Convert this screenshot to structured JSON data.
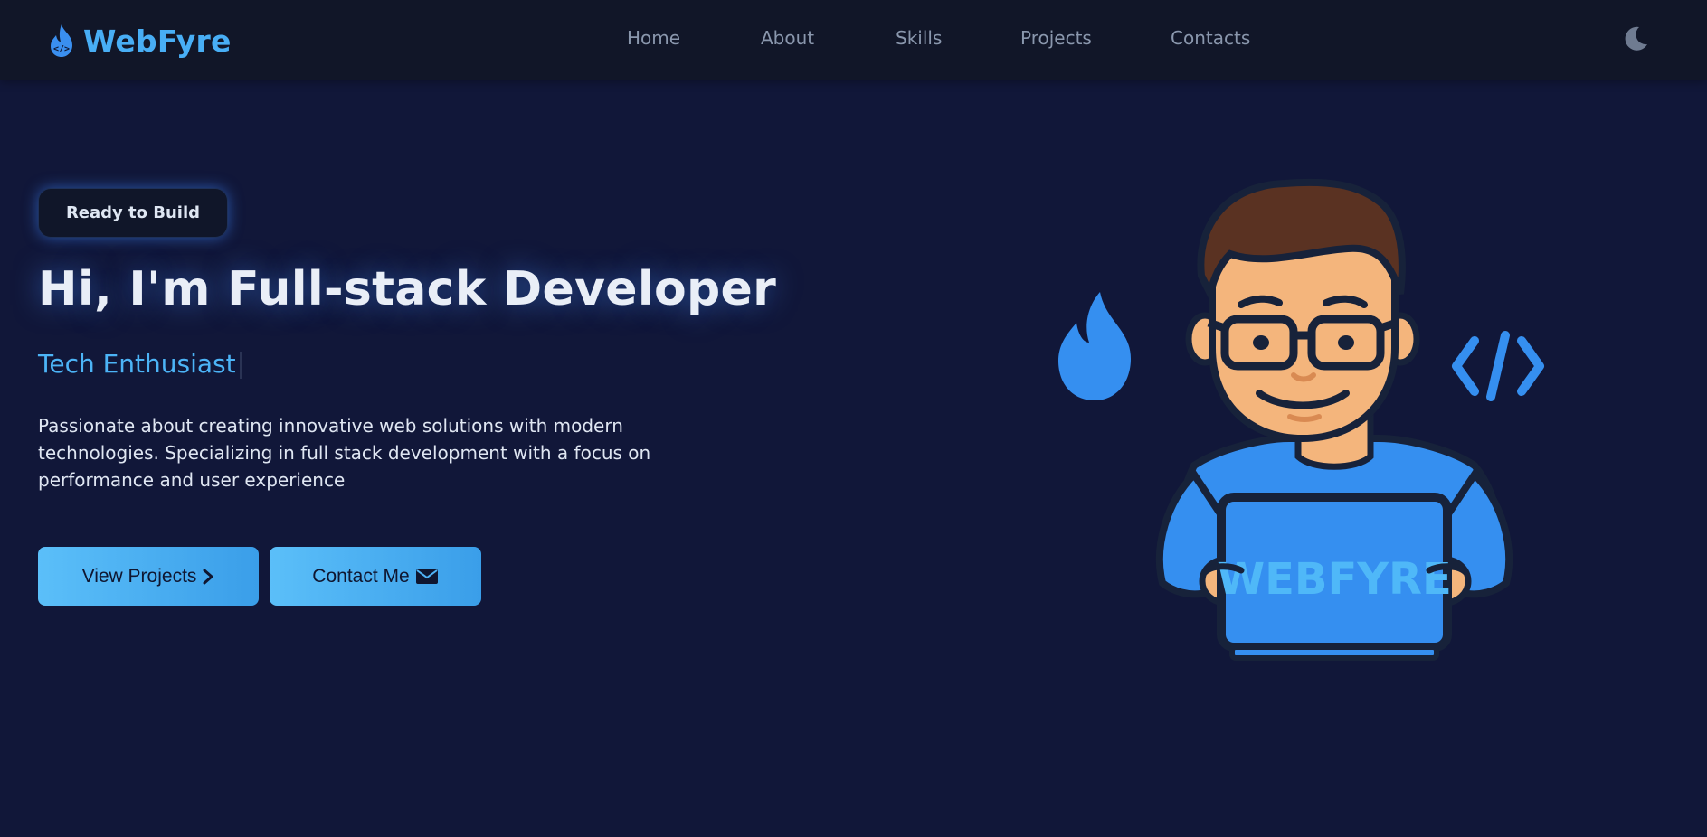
{
  "brand": {
    "name": "WebFyre",
    "icon": "flame-code-icon",
    "color": "#48aef5"
  },
  "nav": {
    "items": [
      {
        "label": "Home"
      },
      {
        "label": "About"
      },
      {
        "label": "Skills"
      },
      {
        "label": "Projects"
      },
      {
        "label": "Contacts"
      }
    ],
    "theme_toggle_icon": "moon-icon"
  },
  "hero": {
    "badge": "Ready to Build",
    "title": "Hi, I'm Full-stack Developer",
    "subtitle": "Tech Enthusiast",
    "description": "Passionate about creating innovative web solutions with modern technologies. Specializing in full stack development with a focus on performance and user experience",
    "buttons": {
      "projects_label": "View Projects",
      "projects_icon": "chevron-right-icon",
      "contact_label": "Contact Me",
      "contact_icon": "envelope-icon"
    },
    "illustration": {
      "laptop_text": "WEBFYRE",
      "left_icon": "flame-icon",
      "right_icon": "code-icon"
    }
  },
  "colors": {
    "background": "#111739",
    "navbar": "#111628",
    "accent": "#4cb4f7",
    "button": "#4fb3f6"
  }
}
